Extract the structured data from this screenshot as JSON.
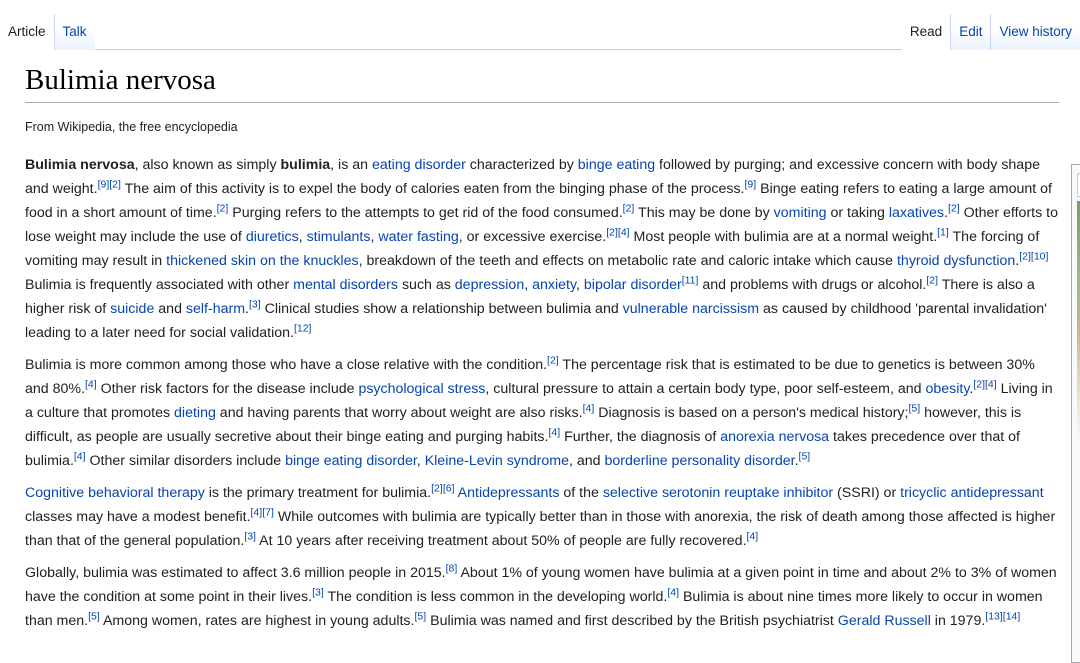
{
  "tabs": {
    "left": [
      {
        "label": "Article",
        "selected": true
      },
      {
        "label": "Talk",
        "selected": false
      }
    ],
    "right": [
      {
        "label": "Read",
        "selected": true
      },
      {
        "label": "Edit",
        "selected": false
      },
      {
        "label": "View history",
        "selected": false
      }
    ]
  },
  "page": {
    "title": "Bulimia nervosa",
    "tagline": "From Wikipedia, the free encyclopedia"
  },
  "colors": {
    "link": "#0645ad",
    "text": "#202122",
    "tab_border": "#a7d7f9"
  },
  "paragraphs": [
    [
      {
        "t": "Bulimia nervosa",
        "b": true
      },
      {
        "t": ", also known as simply "
      },
      {
        "t": "bulimia",
        "b": true
      },
      {
        "t": ", is an "
      },
      {
        "t": "eating disorder",
        "link": true
      },
      {
        "t": " characterized by "
      },
      {
        "t": "binge eating",
        "link": true
      },
      {
        "t": " followed by purging; and excessive concern with body shape and weight."
      },
      {
        "t": "[9]",
        "sup": true
      },
      {
        "t": "[2]",
        "sup": true
      },
      {
        "t": " The aim of this activity is to expel the body of calories eaten from the binging phase of the process."
      },
      {
        "t": "[9]",
        "sup": true
      },
      {
        "t": " Binge eating refers to eating a large amount of food in a short amount of time."
      },
      {
        "t": "[2]",
        "sup": true
      },
      {
        "t": " Purging refers to the attempts to get rid of the food consumed."
      },
      {
        "t": "[2]",
        "sup": true
      },
      {
        "t": " This may be done by "
      },
      {
        "t": "vomiting",
        "link": true
      },
      {
        "t": " or taking "
      },
      {
        "t": "laxatives",
        "link": true
      },
      {
        "t": "."
      },
      {
        "t": "[2]",
        "sup": true
      },
      {
        "t": " Other efforts to lose weight may include the use of "
      },
      {
        "t": "diuretics",
        "link": true
      },
      {
        "t": ", "
      },
      {
        "t": "stimulants",
        "link": true
      },
      {
        "t": ", "
      },
      {
        "t": "water fasting",
        "link": true
      },
      {
        "t": ", or excessive exercise."
      },
      {
        "t": "[2]",
        "sup": true
      },
      {
        "t": "[4]",
        "sup": true
      },
      {
        "t": " Most people with bulimia are at a normal weight."
      },
      {
        "t": "[1]",
        "sup": true
      },
      {
        "t": " The forcing of vomiting may result in "
      },
      {
        "t": "thickened skin on the knuckles",
        "link": true
      },
      {
        "t": ", breakdown of the teeth and effects on metabolic rate and caloric intake which cause "
      },
      {
        "t": "thyroid dysfunction",
        "link": true
      },
      {
        "t": "."
      },
      {
        "t": "[2]",
        "sup": true
      },
      {
        "t": "[10]",
        "sup": true
      },
      {
        "t": " Bulimia is frequently associated with other "
      },
      {
        "t": "mental disorders",
        "link": true
      },
      {
        "t": " such as "
      },
      {
        "t": "depression",
        "link": true
      },
      {
        "t": ", "
      },
      {
        "t": "anxiety",
        "link": true
      },
      {
        "t": ", "
      },
      {
        "t": "bipolar disorder",
        "link": true
      },
      {
        "t": "[11]",
        "sup": true
      },
      {
        "t": " and problems with drugs or alcohol."
      },
      {
        "t": "[2]",
        "sup": true
      },
      {
        "t": " There is also a higher risk of "
      },
      {
        "t": "suicide",
        "link": true
      },
      {
        "t": " and "
      },
      {
        "t": "self-harm",
        "link": true
      },
      {
        "t": "."
      },
      {
        "t": "[3]",
        "sup": true
      },
      {
        "t": " Clinical studies show a relationship between bulimia and "
      },
      {
        "t": "vulnerable narcissism",
        "link": true
      },
      {
        "t": " as caused by childhood 'parental invalidation' leading to a later need for social validation."
      },
      {
        "t": "[12]",
        "sup": true
      }
    ],
    [
      {
        "t": "Bulimia is more common among those who have a close relative with the condition."
      },
      {
        "t": "[2]",
        "sup": true
      },
      {
        "t": " The percentage risk that is estimated to be due to genetics is between 30% and 80%."
      },
      {
        "t": "[4]",
        "sup": true
      },
      {
        "t": " Other risk factors for the disease include "
      },
      {
        "t": "psychological stress",
        "link": true
      },
      {
        "t": ", cultural pressure to attain a certain body type, poor self-esteem, and "
      },
      {
        "t": "obesity",
        "link": true
      },
      {
        "t": "."
      },
      {
        "t": "[2]",
        "sup": true
      },
      {
        "t": "[4]",
        "sup": true
      },
      {
        "t": " Living in a culture that promotes "
      },
      {
        "t": "dieting",
        "link": true
      },
      {
        "t": " and having parents that worry about weight are also risks."
      },
      {
        "t": "[4]",
        "sup": true
      },
      {
        "t": " Diagnosis is based on a person's medical history;"
      },
      {
        "t": "[5]",
        "sup": true
      },
      {
        "t": " however, this is difficult, as people are usually secretive about their binge eating and purging habits."
      },
      {
        "t": "[4]",
        "sup": true
      },
      {
        "t": " Further, the diagnosis of "
      },
      {
        "t": "anorexia nervosa",
        "link": true
      },
      {
        "t": " takes precedence over that of bulimia."
      },
      {
        "t": "[4]",
        "sup": true
      },
      {
        "t": " Other similar disorders include "
      },
      {
        "t": "binge eating disorder",
        "link": true
      },
      {
        "t": ", "
      },
      {
        "t": "Kleine-Levin syndrome",
        "link": true
      },
      {
        "t": ", and "
      },
      {
        "t": "borderline personality disorder",
        "link": true
      },
      {
        "t": "."
      },
      {
        "t": "[5]",
        "sup": true
      }
    ],
    [
      {
        "t": "Cognitive behavioral therapy",
        "link": true
      },
      {
        "t": " is the primary treatment for bulimia."
      },
      {
        "t": "[2]",
        "sup": true
      },
      {
        "t": "[6]",
        "sup": true
      },
      {
        "t": " "
      },
      {
        "t": "Antidepressants",
        "link": true
      },
      {
        "t": " of the "
      },
      {
        "t": "selective serotonin reuptake inhibitor",
        "link": true
      },
      {
        "t": " (SSRI) or "
      },
      {
        "t": "tricyclic antidepressant",
        "link": true
      },
      {
        "t": " classes may have a modest benefit."
      },
      {
        "t": "[4]",
        "sup": true
      },
      {
        "t": "[7]",
        "sup": true
      },
      {
        "t": " While outcomes with bulimia are typically better than in those with anorexia, the risk of death among those affected is higher than that of the general population."
      },
      {
        "t": "[3]",
        "sup": true
      },
      {
        "t": " At 10 years after receiving treatment about 50% of people are fully recovered."
      },
      {
        "t": "[4]",
        "sup": true
      }
    ],
    [
      {
        "t": "Globally, bulimia was estimated to affect 3.6 million people in 2015."
      },
      {
        "t": "[8]",
        "sup": true
      },
      {
        "t": " About 1% of young women have bulimia at a given point in time and about 2% to 3% of women have the condition at some point in their lives."
      },
      {
        "t": "[3]",
        "sup": true
      },
      {
        "t": " The condition is less common in the developing world."
      },
      {
        "t": "[4]",
        "sup": true
      },
      {
        "t": " Bulimia is about nine times more likely to occur in women than men."
      },
      {
        "t": "[5]",
        "sup": true
      },
      {
        "t": " Among women, rates are highest in young adults."
      },
      {
        "t": "[5]",
        "sup": true
      },
      {
        "t": " Bulimia was named and first described by the British psychiatrist "
      },
      {
        "t": "Gerald Russell",
        "link": true
      },
      {
        "t": " in 1979."
      },
      {
        "t": "[13]",
        "sup": true
      },
      {
        "t": "[14]",
        "sup": true
      }
    ]
  ]
}
